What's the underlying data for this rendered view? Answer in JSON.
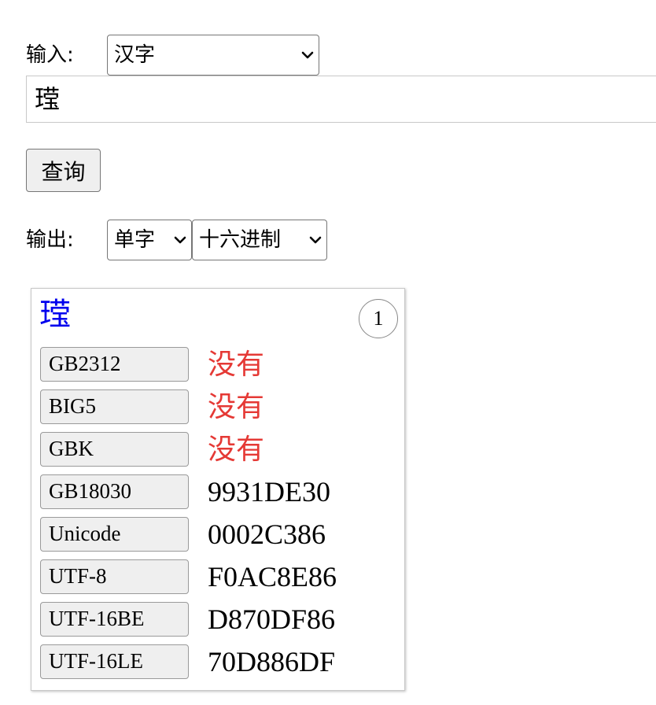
{
  "input_section": {
    "label": "输入:",
    "type_select_value": "汉字",
    "text_value": "𬎆"
  },
  "query_button_label": "查询",
  "output_section": {
    "label": "输出:",
    "mode_select_value": "单字",
    "format_select_value": "十六进制"
  },
  "result": {
    "character": "𬎆",
    "index": "1",
    "colors": {
      "missing": "#e53935",
      "char_link": "#0000ee"
    },
    "encodings": [
      {
        "name": "GB2312",
        "value": "没有",
        "missing": true
      },
      {
        "name": "BIG5",
        "value": "没有",
        "missing": true
      },
      {
        "name": "GBK",
        "value": "没有",
        "missing": true
      },
      {
        "name": "GB18030",
        "value": "9931DE30",
        "missing": false
      },
      {
        "name": "Unicode",
        "value": "0002C386",
        "missing": false
      },
      {
        "name": "UTF-8",
        "value": "F0AC8E86",
        "missing": false
      },
      {
        "name": "UTF-16BE",
        "value": "D870DF86",
        "missing": false
      },
      {
        "name": "UTF-16LE",
        "value": "70D886DF",
        "missing": false
      }
    ]
  }
}
